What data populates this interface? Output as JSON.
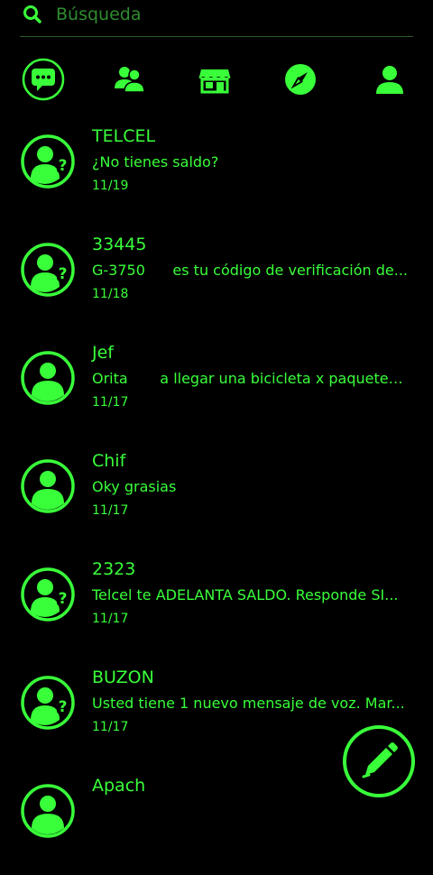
{
  "search": {
    "placeholder": "Búsqueda"
  },
  "tabs": [
    {
      "icon": "chat-bubble-icon"
    },
    {
      "icon": "contacts-icon"
    },
    {
      "icon": "store-icon"
    },
    {
      "icon": "compass-icon"
    },
    {
      "icon": "profile-icon"
    }
  ],
  "conversations": [
    {
      "name": "TELCEL",
      "preview": "¿No tienes saldo?",
      "date": "11/19"
    },
    {
      "name": "33445",
      "preview": "G-3750      es tu código de verificación de...",
      "date": "11/18"
    },
    {
      "name": "Jef",
      "preview": "Orita       a llegar una bicicleta x paqueteri...",
      "date": "11/17"
    },
    {
      "name": "Chif",
      "preview": "Oky grasias",
      "date": "11/17"
    },
    {
      "name": "2323",
      "preview": "Telcel te ADELANTA SALDO. Responde SI...",
      "date": "11/17"
    },
    {
      "name": "BUZON",
      "preview": "Usted tiene 1 nuevo mensaje de voz. Mar...",
      "date": "11/17"
    },
    {
      "name": "Apach",
      "preview": "",
      "date": ""
    }
  ],
  "colors": {
    "accent": "#39ff3a",
    "background": "#000000"
  },
  "fab": {
    "icon": "pencil-icon"
  }
}
